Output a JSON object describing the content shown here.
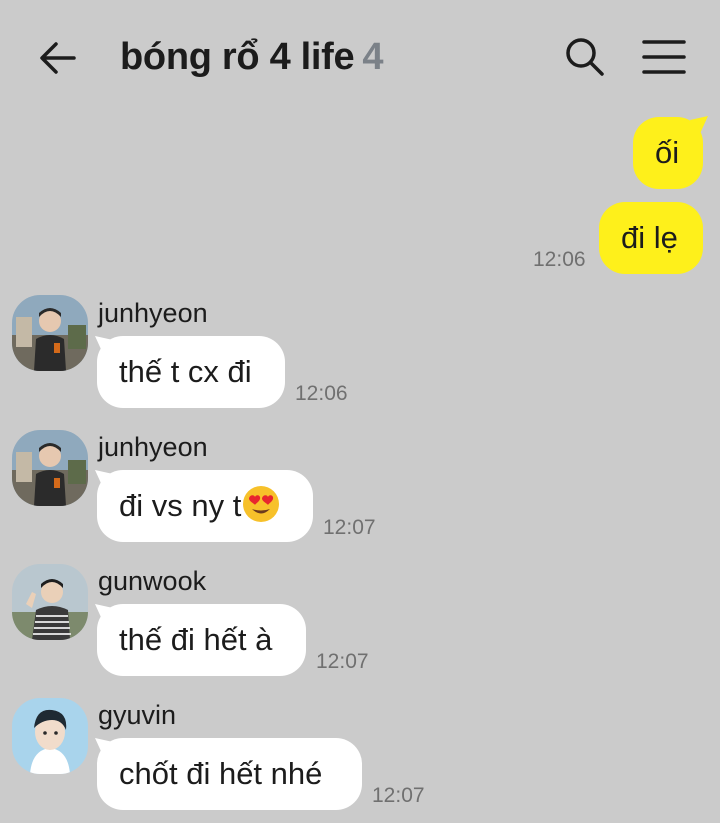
{
  "header": {
    "title": "bóng rổ 4 life",
    "member_count": "4"
  },
  "outgoing": [
    {
      "text": "ối"
    },
    {
      "text": "đi lẹ",
      "time": "12:06"
    }
  ],
  "incoming": [
    {
      "sender": "junhyeon",
      "text": "thế t cx đi",
      "time": "12:06"
    },
    {
      "sender": "junhyeon",
      "text": "đi vs ny t",
      "emoji": "heart-eyes-emoji",
      "time": "12:07"
    },
    {
      "sender": "gunwook",
      "text": "thế đi hết à",
      "time": "12:07"
    },
    {
      "sender": "gyuvin",
      "text": "chốt đi hết nhé",
      "time": "12:07"
    }
  ],
  "colors": {
    "background": "#cbcbcb",
    "my_bubble": "#fef01b",
    "their_bubble": "#ffffff",
    "timestamp": "#707070",
    "member_count": "#7b8188"
  }
}
